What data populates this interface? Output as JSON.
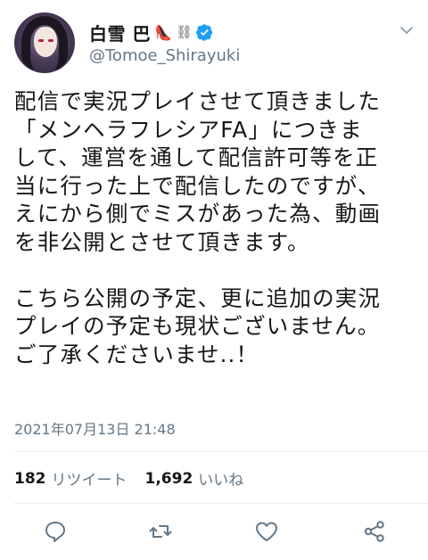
{
  "user": {
    "display_name": "白雪 巴",
    "emoji": "👠",
    "chain": "⛓",
    "handle": "@Tomoe_Shirayuki"
  },
  "tweet": {
    "text": "配信で実況プレイさせて頂きました\n「メンヘラフレシアFA」につきま\nして、運営を通して配信許可等を正\n当に行った上で配信したのですが、\nえにから側でミスがあった為、動画\nを非公開とさせて頂きます。\n\nこちら公開の予定、更に追加の実況\nプレイの予定も現状ございません。\nご了承くださいませ..！",
    "timestamp": "2021年07月13日 21:48"
  },
  "stats": {
    "retweets_count": "182",
    "retweets_label": "リツイート",
    "likes_count": "1,692",
    "likes_label": "いいね"
  },
  "colors": {
    "verified": "#1da1f2",
    "secondary_text": "#657786",
    "icon": "#657786"
  },
  "icons": [
    "chevron-down-icon",
    "verified-icon",
    "reply-icon",
    "retweet-icon",
    "like-icon",
    "share-icon"
  ]
}
